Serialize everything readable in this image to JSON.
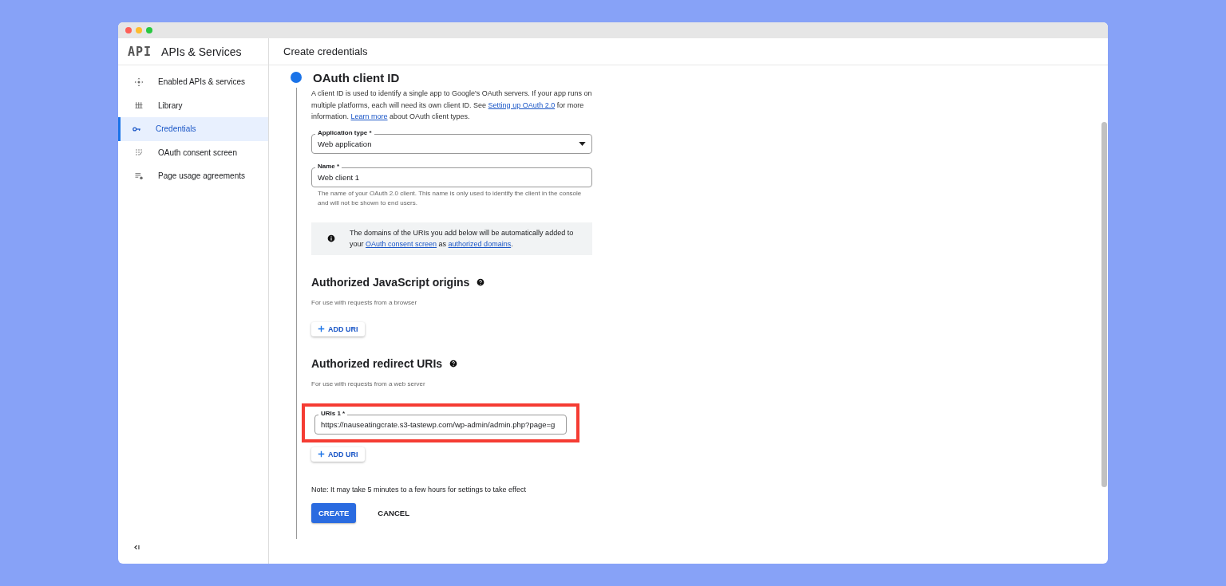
{
  "sidebar": {
    "logo": "API",
    "title": "APIs & Services",
    "items": [
      {
        "label": "Enabled APIs & services",
        "kind": "move",
        "selected": false
      },
      {
        "label": "Library",
        "kind": "library",
        "selected": false
      },
      {
        "label": "Credentials",
        "kind": "key",
        "selected": true
      },
      {
        "label": "OAuth consent screen",
        "kind": "consent",
        "selected": false
      },
      {
        "label": "Page usage agreements",
        "kind": "agreements",
        "selected": false
      }
    ]
  },
  "header": {
    "title": "Create credentials"
  },
  "step": {
    "title": "OAuth client ID",
    "intro": [
      {
        "kind": "text",
        "text": "A client ID is used to identify a single app to Google's OAuth servers. If your app runs on multiple platforms, each will need its own client ID. See "
      },
      {
        "kind": "link",
        "text": "Setting up OAuth 2.0"
      },
      {
        "kind": "text",
        "text": " for more information. "
      },
      {
        "kind": "link",
        "text": "Learn more"
      },
      {
        "kind": "text",
        "text": " about OAuth client types."
      }
    ],
    "application_type": {
      "label": "Application type *",
      "value": "Web application"
    },
    "name": {
      "label": "Name *",
      "value": "Web client 1",
      "hint": "The name of your OAuth 2.0 client. This name is only used to identify the client in the console and will not be shown to end users."
    },
    "info": [
      {
        "kind": "text",
        "text": "The domains of the URIs you add below will be automatically added to your "
      },
      {
        "kind": "link",
        "text": "OAuth consent screen"
      },
      {
        "kind": "text",
        "text": " as "
      },
      {
        "kind": "link",
        "text": "authorized domains"
      },
      {
        "kind": "text",
        "text": "."
      }
    ],
    "js_origins": {
      "title": "Authorized JavaScript origins",
      "subtitle": "For use with requests from a browser",
      "add_button": "ADD URI"
    },
    "redirect_uris": {
      "title": "Authorized redirect URIs",
      "subtitle": "For use with requests from a web server",
      "add_button": "ADD URI",
      "uris": [
        {
          "label": "URIs 1 *",
          "value": "https://nauseatingcrate.s3-tastewp.com/wp-admin/admin.php?page=g",
          "highlighted": true
        }
      ]
    },
    "note": "Note: It may take 5 minutes to a few hours for settings to take effect",
    "buttons": [
      {
        "label": "CREATE",
        "kind": "primary"
      },
      {
        "label": "CANCEL",
        "kind": "text"
      }
    ]
  }
}
